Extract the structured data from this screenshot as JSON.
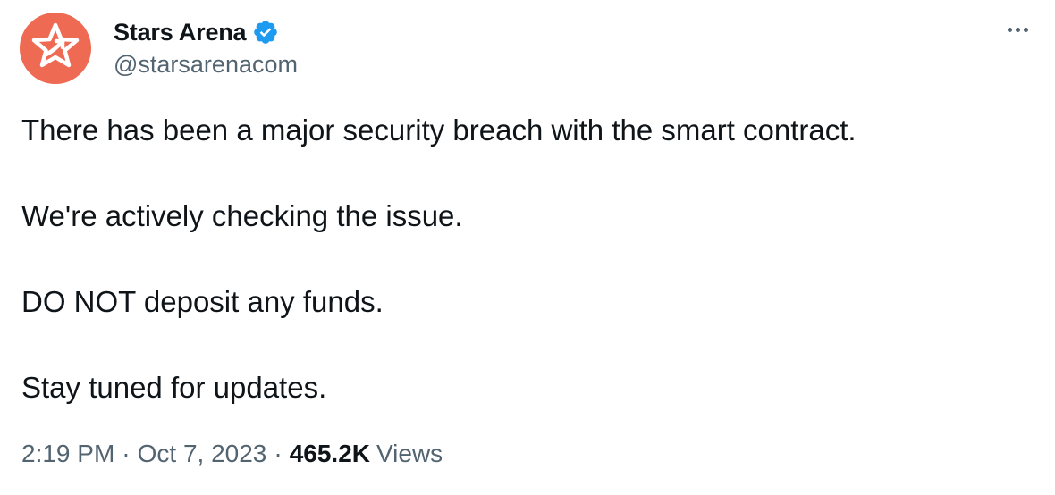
{
  "author": {
    "display_name": "Stars Arena",
    "handle": "@starsarenacom",
    "verified": true,
    "avatar_color": "#ee6a52",
    "verified_color": "#1d9bf0"
  },
  "tweet": {
    "paragraphs": [
      "There has been a major security breach with the smart contract.",
      "We're actively checking the issue.",
      "DO NOT deposit any funds.",
      "Stay tuned for updates."
    ],
    "time": "2:19 PM",
    "separator": "·",
    "date": "Oct 7, 2023",
    "views_count": "465.2K",
    "views_label": "Views"
  },
  "icons": {
    "avatar": "star-logo-icon",
    "verified": "verified-badge-icon",
    "more": "more-options-icon"
  }
}
